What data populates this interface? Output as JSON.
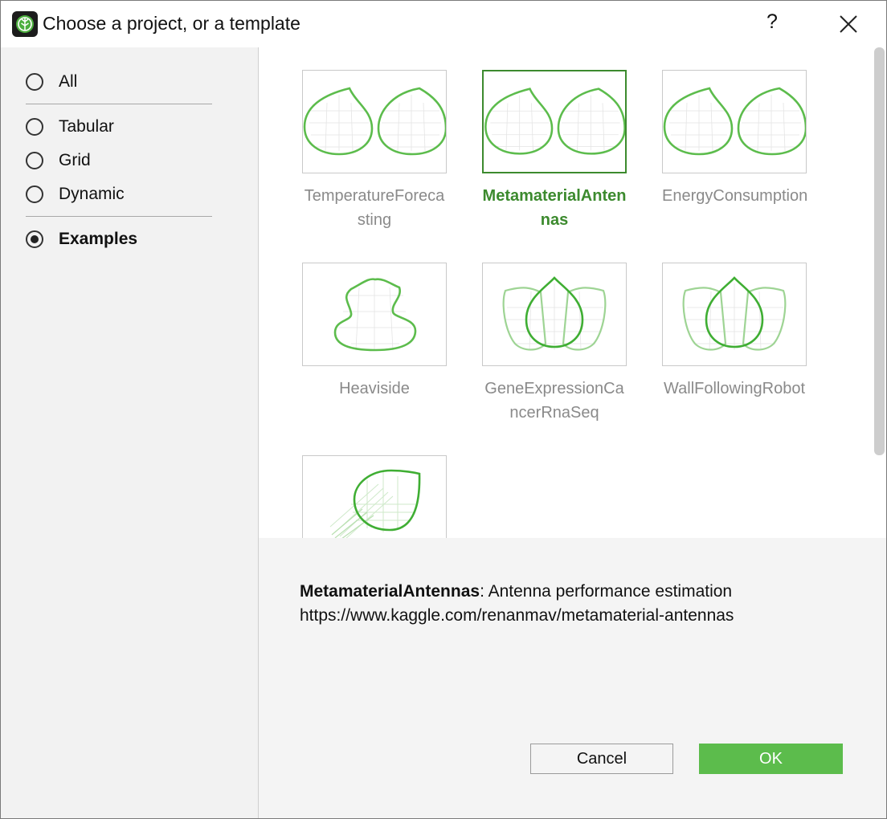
{
  "window": {
    "title": "Choose a project, or a template",
    "help_label": "?"
  },
  "sidebar": {
    "options": [
      {
        "label": "All",
        "selected": false
      },
      {
        "label": "Tabular",
        "selected": false
      },
      {
        "label": "Grid",
        "selected": false
      },
      {
        "label": "Dynamic",
        "selected": false
      },
      {
        "label": "Examples",
        "selected": true
      }
    ]
  },
  "templates": [
    {
      "label": "TemperatureForecasting",
      "thumb": "two-drops",
      "selected": false
    },
    {
      "label": "MetamaterialAntennas",
      "thumb": "two-drops",
      "selected": true
    },
    {
      "label": "EnergyConsumption",
      "thumb": "two-drops",
      "selected": false
    },
    {
      "label": "Heaviside",
      "thumb": "curvy-blob",
      "selected": false
    },
    {
      "label": "GeneExpressionCancerRnaSeq",
      "thumb": "three-drops",
      "selected": false
    },
    {
      "label": "WallFollowingRobot",
      "thumb": "three-drops",
      "selected": false
    },
    {
      "label": "",
      "thumb": "tilted-drop",
      "selected": false
    }
  ],
  "details": {
    "name": "MetamaterialAntennas",
    "separator": ":",
    "description": " Antenna performance estimation",
    "url": "https://www.kaggle.com/renanmav/metamaterial-antennas"
  },
  "buttons": {
    "cancel": "Cancel",
    "ok": "OK"
  },
  "colors": {
    "accent_green": "#5cbc4c",
    "selected_green": "#3c8a2e",
    "sidebar_bg": "#f2f2f2"
  },
  "icons": {
    "app": "leaf-app-icon",
    "close": "close-icon"
  }
}
